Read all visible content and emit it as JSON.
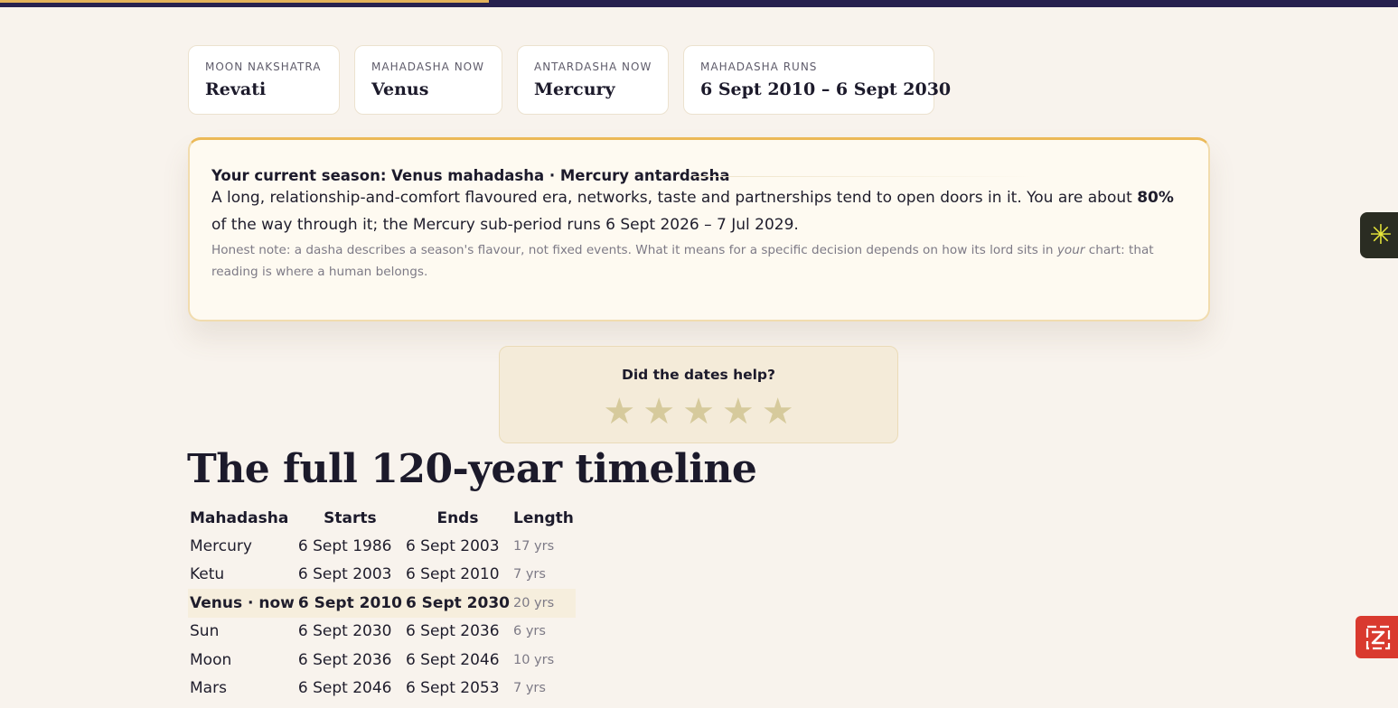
{
  "progress": {
    "fraction": 0.35,
    "color": "#e3b25a"
  },
  "stats": [
    {
      "label": "MOON NAKSHATRA",
      "value": "Revati"
    },
    {
      "label": "MAHADASHA NOW",
      "value": "Venus"
    },
    {
      "label": "ANTARDASHA NOW",
      "value": "Mercury"
    },
    {
      "label": "MAHADASHA RUNS",
      "value": "6 Sept 2010 – 6 Sept 2030"
    }
  ],
  "season": {
    "title": "Your current season: Venus mahadasha · Mercury antardasha",
    "body_before": "A long, relationship-and-comfort flavoured era, networks, taste and partnerships tend to open doors in it. You are about ",
    "percent": "80%",
    "body_after": " of the way through it; the Mercury sub-period runs 6 Sept 2026 – 7 Jul 2029.",
    "note_before": "Honest note: a dasha describes a season's flavour, not fixed events. What it means for a specific decision depends on how its lord sits in ",
    "note_em": "your",
    "note_after": " chart: that reading is where a human belongs."
  },
  "rating": {
    "question": "Did the dates help?",
    "star_glyph": "★",
    "stars": 5,
    "selected": 0
  },
  "timeline": {
    "title": "The full 120-year timeline",
    "columns": [
      "Mahadasha",
      "Starts",
      "Ends",
      "Length"
    ],
    "rows": [
      {
        "name": "Mercury",
        "starts": "6 Sept 1986",
        "ends": "6 Sept 2003",
        "length": "17 yrs"
      },
      {
        "name": "Ketu",
        "starts": "6 Sept 2003",
        "ends": "6 Sept 2010",
        "length": "7 yrs"
      },
      {
        "name": "Venus · now",
        "starts": "6 Sept 2010",
        "ends": "6 Sept 2030",
        "length": "20 yrs"
      },
      {
        "name": "Sun",
        "starts": "6 Sept 2030",
        "ends": "6 Sept 2036",
        "length": "6 yrs"
      },
      {
        "name": "Moon",
        "starts": "6 Sept 2036",
        "ends": "6 Sept 2046",
        "length": "10 yrs"
      },
      {
        "name": "Mars",
        "starts": "6 Sept 2046",
        "ends": "6 Sept 2053",
        "length": "7 yrs"
      }
    ]
  },
  "widgets": {
    "right_icon": "asterisk-icon",
    "bottom_icon": "zendesk-icon"
  }
}
